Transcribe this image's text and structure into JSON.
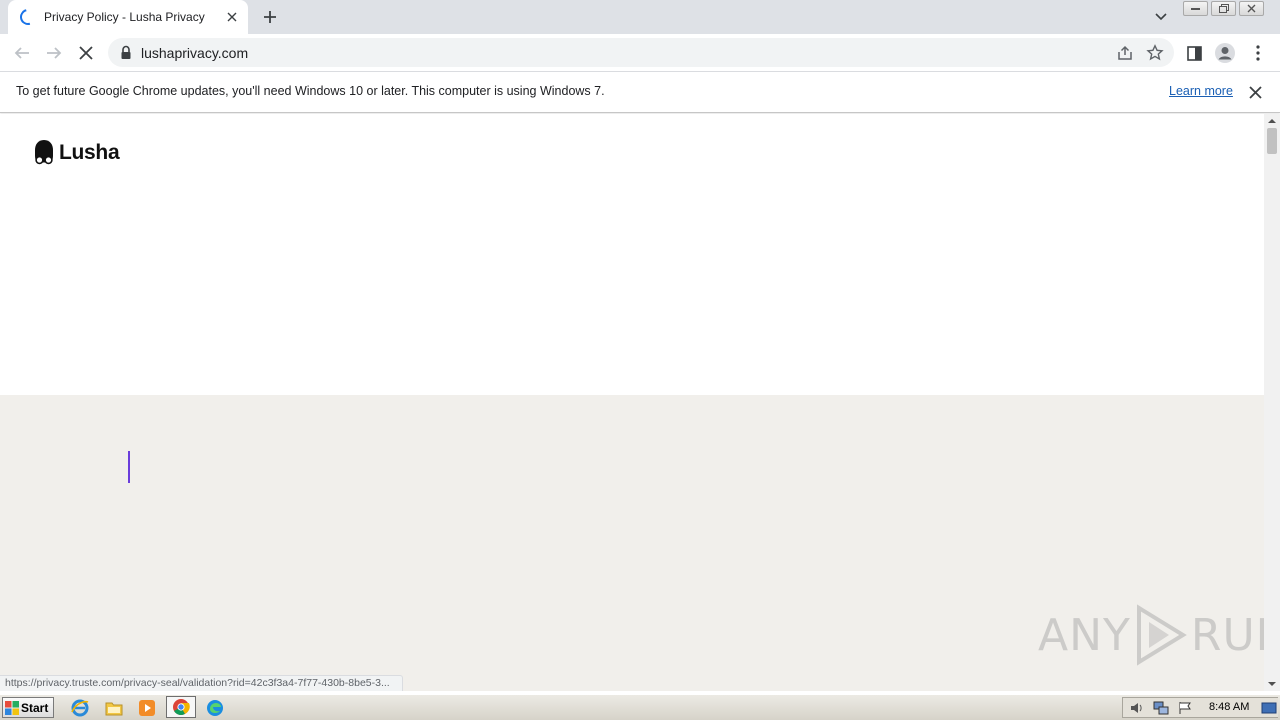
{
  "browser": {
    "tab": {
      "title": "Privacy Policy - Lusha Privacy"
    },
    "address_bar": {
      "url": "lushaprivacy.com"
    }
  },
  "infobar": {
    "message": "To get future Google Chrome updates, you'll need Windows 10 or later. This computer is using Windows 7.",
    "link": "Learn more"
  },
  "page": {
    "logo_text": "Lusha",
    "status_url": "https://privacy.truste.com/privacy-seal/validation?rid=42c3f3a4-7f77-430b-8be5-3...",
    "colors": {
      "top_band": "#ffffff",
      "lower_band": "#f1efeb",
      "caret": "#6a3ddb"
    }
  },
  "watermark": {
    "left": "ANY",
    "right": "RUN"
  },
  "taskbar": {
    "start_label": "Start",
    "clock": "8:48 AM",
    "pinned": [
      "ie-icon",
      "explorer-icon",
      "media-player-icon",
      "chrome-icon",
      "edge-icon"
    ]
  }
}
